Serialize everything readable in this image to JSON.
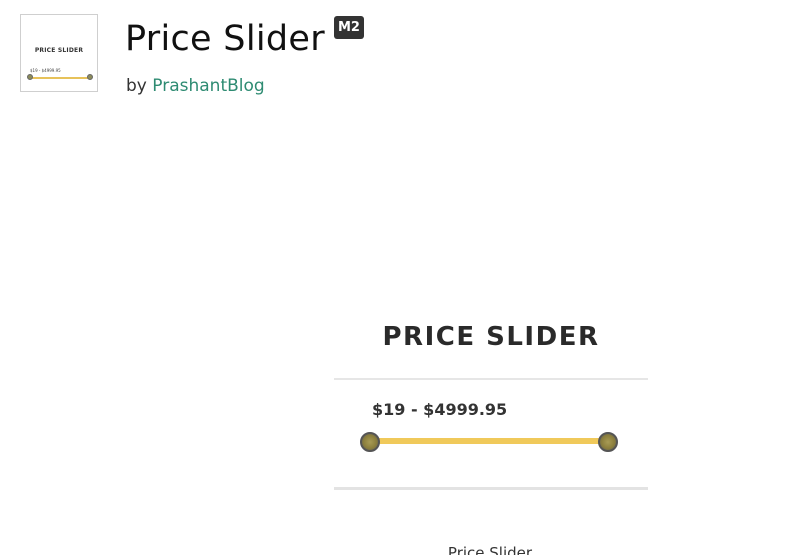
{
  "header": {
    "thumbnail": {
      "title": "PRICE SLIDER",
      "range": "$19 - $4999.95"
    },
    "title": "Price Slider",
    "badge": "M2",
    "by_label": "by",
    "author": "PrashantBlog"
  },
  "preview": {
    "title": "PRICE SLIDER",
    "range": "$19 - $4999.95",
    "slider": {
      "min_value": 19,
      "max_value": 4999.95
    },
    "caption": "Price Slider"
  },
  "colors": {
    "accent_link": "#2e8b72",
    "slider_track": "#f0c95a",
    "badge_bg": "#333333"
  }
}
